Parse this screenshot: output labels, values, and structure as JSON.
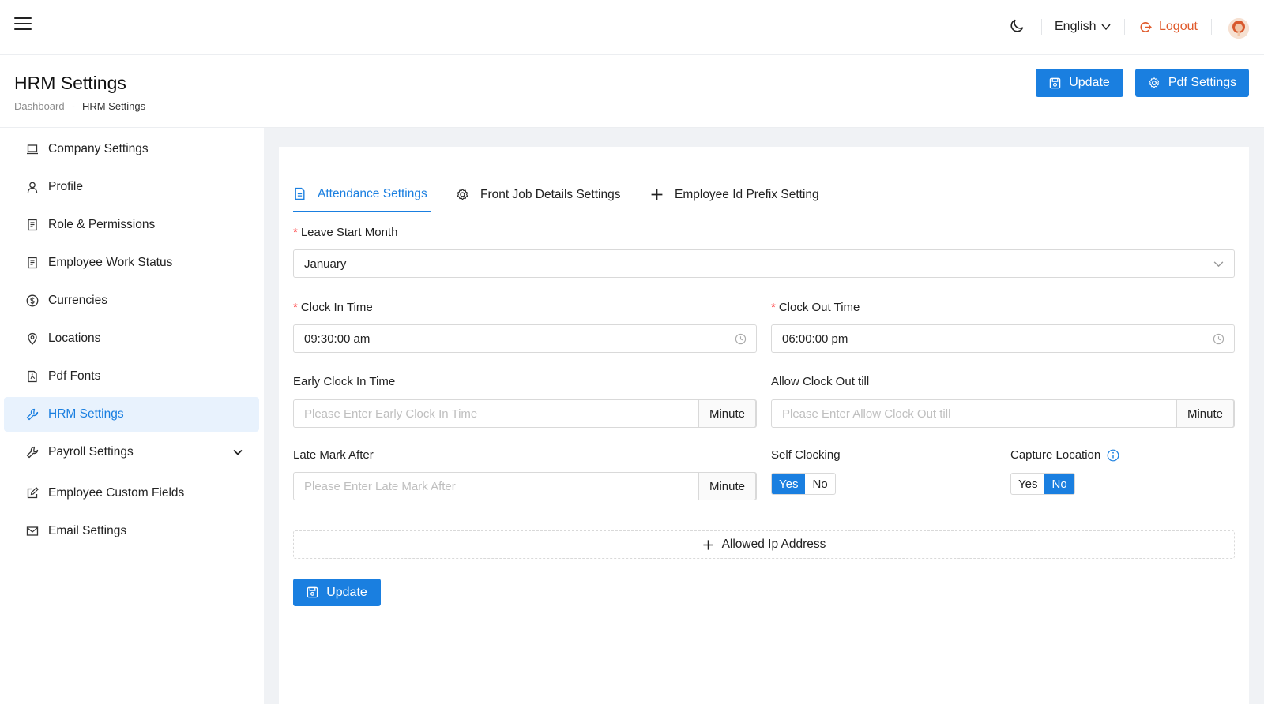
{
  "topbar": {
    "language": "English",
    "logout_label": "Logout"
  },
  "header": {
    "title": "HRM Settings",
    "breadcrumb": [
      "Dashboard",
      "-",
      "HRM Settings"
    ],
    "update_label": "Update",
    "pdf_settings_label": "Pdf Settings"
  },
  "sidebar": {
    "items": [
      {
        "label": "Company Settings",
        "icon": "laptop-icon"
      },
      {
        "label": "Profile",
        "icon": "user-icon"
      },
      {
        "label": "Role & Permissions",
        "icon": "document-icon"
      },
      {
        "label": "Employee Work Status",
        "icon": "document-icon"
      },
      {
        "label": "Currencies",
        "icon": "dollar-circle-icon"
      },
      {
        "label": "Locations",
        "icon": "location-pin-icon"
      },
      {
        "label": "Pdf Fonts",
        "icon": "file-pdf-icon"
      },
      {
        "label": "HRM Settings",
        "icon": "tool-icon"
      },
      {
        "label": "Payroll Settings",
        "icon": "tool-icon"
      },
      {
        "label": "Employee Custom Fields",
        "icon": "edit-icon"
      },
      {
        "label": "Email Settings",
        "icon": "mail-icon"
      }
    ],
    "active_item": "HRM Settings"
  },
  "tabs": [
    {
      "label": "Attendance Settings",
      "icon": "file-icon",
      "active": true
    },
    {
      "label": "Front Job Details Settings",
      "icon": "gear-icon",
      "active": false
    },
    {
      "label": "Employee Id Prefix Setting",
      "icon": "plus-icon",
      "active": false
    }
  ],
  "form": {
    "leave_start_month": {
      "label": "Leave Start Month",
      "value": "January"
    },
    "clock_in_time": {
      "label": "Clock In Time",
      "value": "09:30:00 am"
    },
    "clock_out_time": {
      "label": "Clock Out Time",
      "value": "06:00:00 pm"
    },
    "early_clock_in": {
      "label": "Early Clock In Time",
      "placeholder": "Please Enter Early Clock In Time",
      "addon": "Minute"
    },
    "allow_clock_out": {
      "label": "Allow Clock Out till",
      "placeholder": "Please Enter Allow Clock Out till",
      "addon": "Minute"
    },
    "late_mark_after": {
      "label": "Late Mark After",
      "placeholder": "Please Enter Late Mark After",
      "addon": "Minute"
    },
    "self_clocking": {
      "label": "Self Clocking",
      "yes": "Yes",
      "no": "No",
      "selected": "Yes"
    },
    "capture_location": {
      "label": "Capture Location",
      "yes": "Yes",
      "no": "No",
      "selected": "No"
    },
    "allowed_ip_label": "Allowed Ip Address",
    "update_label": "Update"
  },
  "colors": {
    "primary": "#1a7fe0",
    "logout": "#e05a2b",
    "required": "#ff4d4f"
  }
}
